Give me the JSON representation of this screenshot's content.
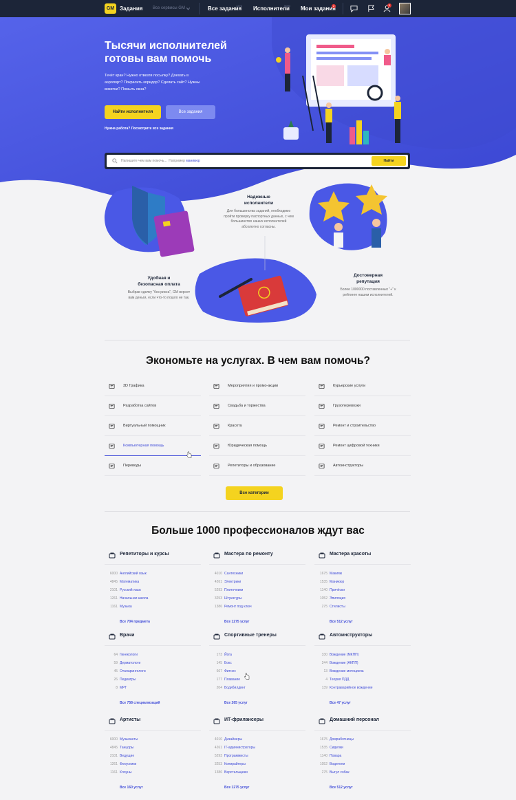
{
  "topbar": {
    "logo": "GM",
    "tasks_label": "Задания",
    "services_label": "Все сервисы GM",
    "all_tasks": "Все задания",
    "all_tasks_count": "1276",
    "performers": "Исполнители",
    "performers_count": "5000",
    "my_tasks": "Мои задания",
    "my_tasks_badge": "2",
    "notif_badge": "3"
  },
  "hero": {
    "title": "Тысячи исполнителей готовы вам помочь",
    "subtitle": "Течёт кран? Нужно отвезти посылку? Доехать в аэропорт? Покрасить коридор? Сделать сайт? Нужны визитки? Помыть окна?",
    "btn_find": "Найти исполнителя",
    "btn_tasks": "Все задания",
    "work_link": "Нужна работа? Посмотрите все задания"
  },
  "search": {
    "placeholder": "Напишите чем вам помочь...",
    "example_prefix": "Например",
    "example": "маникюр",
    "button": "Найти"
  },
  "features": {
    "reliable_title": "Надежные исполнители",
    "reliable_text": "Для большинства заданий, необходимо пройти проверку паспортных данных, с чем большинство наших исполнителей абсолютно согласны.",
    "safe_title": "Удобная и безопасная оплата",
    "safe_text": "Выбрав сделку \"без риска\", GM вернет вам деньги, если что-то пошло не так.",
    "rating_title": "Достоверная репутация",
    "rating_text": "Более 1000000 поставленных \"+\" к рейтинге нашим исполнителей."
  },
  "categories_title": "Экономьте на услугах. В чем вам помочь?",
  "categories": [
    [
      "3D Графика",
      "Мероприятия и промо-акции",
      "Курьерские услуги"
    ],
    [
      "Разработка сайтов",
      "Свадьба и торжества",
      "Грузоперевозки"
    ],
    [
      "Виртуальный помощник",
      "Красота",
      "Ремонт и строительство"
    ],
    [
      "Компьютерная помощь",
      "Юридическая помощь",
      "Ремонт цифровой техники"
    ],
    [
      "Переводы",
      "Репетиторы и образование",
      "Автоинструкторы"
    ]
  ],
  "all_categories": "Все категории",
  "pros_title": "Больше 1000 профессионалов ждут вас",
  "pros": [
    {
      "title": "Репетиторы и курсы",
      "rows": [
        [
          "6000",
          "Английский язык"
        ],
        [
          "4845",
          "Математика"
        ],
        [
          "2101",
          "Русский язык"
        ],
        [
          "1261",
          "Начальная школа"
        ],
        [
          "1161",
          "Музыка"
        ]
      ],
      "all": "Все 704 предмета"
    },
    {
      "title": "Мастера по ремонту",
      "rows": [
        [
          "4010",
          "Сантехники"
        ],
        [
          "4261",
          "Электрики"
        ],
        [
          "5293",
          "Плиточники"
        ],
        [
          "3253",
          "Штукатуры"
        ],
        [
          "1386",
          "Ремонт под ключ"
        ]
      ],
      "all": "Все 1275 услуг"
    },
    {
      "title": "Мастера красоты",
      "rows": [
        [
          "1675",
          "Макияж"
        ],
        [
          "1535",
          "Маникюр"
        ],
        [
          "1140",
          "Причёски"
        ],
        [
          "1052",
          "Эпиляция"
        ],
        [
          "275",
          "Стилисты"
        ]
      ],
      "all": "Все 512 услуг"
    },
    {
      "title": "Врачи",
      "rows": [
        [
          "64",
          "Гинекологи"
        ],
        [
          "59",
          "Дерматологи"
        ],
        [
          "45",
          "Оталарингологи"
        ],
        [
          "26",
          "Педиатры"
        ],
        [
          "8",
          "МРТ"
        ]
      ],
      "all": "Все 758 специализаций"
    },
    {
      "title": "Спортивные тренеры",
      "rows": [
        [
          "173",
          "Йога"
        ],
        [
          "145",
          "Бокс"
        ],
        [
          "667",
          "Фитнес"
        ],
        [
          "177",
          "Плавание"
        ],
        [
          "204",
          "Бодибилдинг"
        ]
      ],
      "all": "Все 265 услуг"
    },
    {
      "title": "Автоинструкторы",
      "rows": [
        [
          "330",
          "Вождение (МКПП)"
        ],
        [
          "244",
          "Вождение (АКПП)"
        ],
        [
          "13",
          "Вождение мотоцикла"
        ],
        [
          "4",
          "Теория ПДД"
        ],
        [
          "139",
          "Контраварийное вождение"
        ]
      ],
      "all": "Все 47 услуг"
    },
    {
      "title": "Артисты",
      "rows": [
        [
          "6000",
          "Музыканты"
        ],
        [
          "4845",
          "Танцоры"
        ],
        [
          "2101",
          "Ведущие"
        ],
        [
          "1261",
          "Фокусники"
        ],
        [
          "1161",
          "Клоуны"
        ]
      ],
      "all": "Все 160 услуг"
    },
    {
      "title": "ИТ-фрилансеры",
      "rows": [
        [
          "4010",
          "Дизайнеры"
        ],
        [
          "4261",
          "IT-администраторы"
        ],
        [
          "5293",
          "Программисты"
        ],
        [
          "3253",
          "Копирайтеры"
        ],
        [
          "1386",
          "Верстальщики"
        ]
      ],
      "all": "Все 1275 услуг"
    },
    {
      "title": "Домашний персонал",
      "rows": [
        [
          "1675",
          "Домработницы"
        ],
        [
          "1535",
          "Сиделки"
        ],
        [
          "1140",
          "Повара"
        ],
        [
          "1052",
          "Водители"
        ],
        [
          "275",
          "Выгул собак"
        ]
      ],
      "all": "Все 512 услуг"
    }
  ],
  "colors": {
    "accent": "#f4d31f",
    "primary": "#4a58e6",
    "dark": "#1c2538",
    "link": "#3f4bd8"
  }
}
